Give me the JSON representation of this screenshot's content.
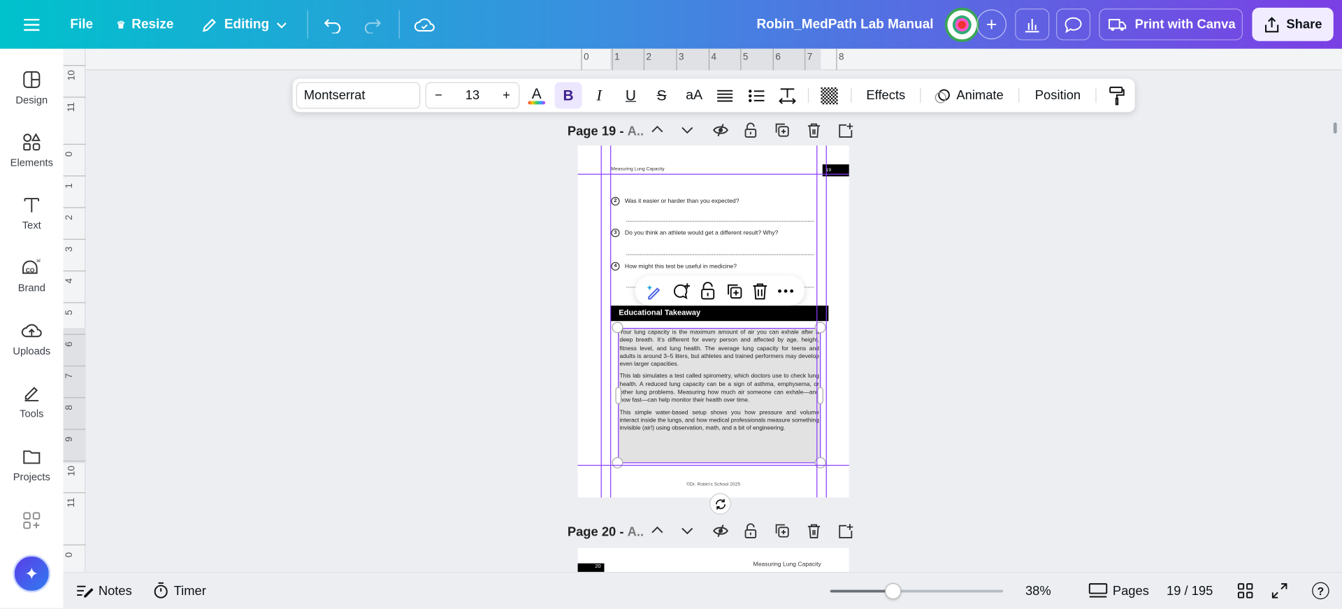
{
  "topbar": {
    "file": "File",
    "resize": "Resize",
    "editing": "Editing",
    "title": "Robin_MedPath Lab Manual",
    "print": "Print with Canva",
    "share": "Share"
  },
  "sidebar": {
    "items": [
      {
        "label": "Design"
      },
      {
        "label": "Elements"
      },
      {
        "label": "Text"
      },
      {
        "label": "Brand"
      },
      {
        "label": "Uploads"
      },
      {
        "label": "Tools"
      },
      {
        "label": "Projects"
      }
    ]
  },
  "rulers": {
    "horizontal": [
      "0",
      "1",
      "2",
      "3",
      "4",
      "5",
      "6",
      "7",
      "8"
    ],
    "vertical": [
      "10",
      "11",
      "0",
      "1",
      "2",
      "3",
      "4",
      "5",
      "6",
      "7",
      "8",
      "9",
      "10",
      "11",
      "0"
    ]
  },
  "text_toolbar": {
    "font": "Montserrat",
    "size": "13",
    "minus": "−",
    "plus": "+",
    "bold": "B",
    "italic": "I",
    "underline": "U",
    "strike": "S",
    "case": "aA",
    "effects": "Effects",
    "animate": "Animate",
    "position": "Position"
  },
  "page19": {
    "label": "Page 19 - ",
    "label_title": "A..",
    "header": "Measuring Lung Capacity",
    "number": "19",
    "questions": [
      {
        "n": "2",
        "text": "Was it easier or harder than you expected?"
      },
      {
        "n": "3",
        "text": "Do you think an athlete would get a different result? Why?"
      },
      {
        "n": "4",
        "text": "How might this test be useful in medicine?"
      }
    ],
    "section_title": "Educational Takeaway",
    "paragraphs": [
      "Your lung capacity is the maximum amount of air you can exhale after a deep breath. It’s different for every person and affected by age, height, fitness level, and lung health. The average lung capacity for teens and adults is around 3–5 liters, but athletes and trained performers may develop even larger capacities.",
      "This lab simulates a test called spirometry, which doctors use to check lung health. A reduced lung capacity can be a sign of asthma, emphysema, or other lung problems. Measuring how much air someone can exhale—and how fast—can help monitor their health over time.",
      "This simple water-based setup shows you how pressure and volume interact inside the lungs, and how medical professionals measure something invisible (air!) using observation, math, and a bit of engineering."
    ],
    "footer": "©Dr. Robin's School 2025"
  },
  "page20": {
    "label": "Page 20 - ",
    "label_title": "A..",
    "number": "20",
    "header": "Measuring Lung Capacity"
  },
  "bottombar": {
    "notes": "Notes",
    "timer": "Timer",
    "zoom": "38%",
    "zoom_value": 38,
    "pages": "Pages",
    "page_count": "19 / 195"
  },
  "colors": {
    "accent": "#8b3dff",
    "brand_gradient_start": "#00c2cc",
    "brand_gradient_end": "#7b3fe4"
  }
}
